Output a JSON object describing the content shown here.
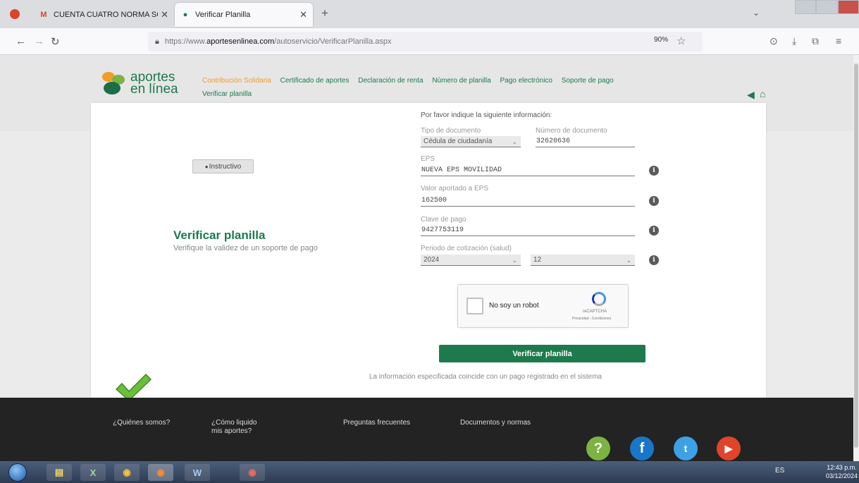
{
  "browser": {
    "tabs": [
      {
        "label": "CUENTA CUATRO NORMA SO",
        "favicon": "gmail-icon",
        "active": false
      },
      {
        "label": "Verificar Planilla",
        "favicon": "aportes-icon",
        "active": true
      }
    ],
    "url_prefix": "https://www.",
    "url_host": "aportesenlinea.com",
    "url_path": "/autoservicio/VerificarPlanilla.aspx",
    "zoom": "90%"
  },
  "site": {
    "logo_line1": "aportes",
    "logo_line2": "en línea",
    "nav": [
      "Contribución Solidaria",
      "Certificado de aportes",
      "Declaración de renta",
      "Número de planilla",
      "Pago electrónico",
      "Soporte de pago",
      "Verificar planilla"
    ],
    "accent_color": "#1d7a4c",
    "active_nav_color": "#f39c28"
  },
  "left": {
    "instructivo_label": "Instructivo",
    "title": "Verificar planilla",
    "subtitle": "Verifique la validez de un soporte de pago"
  },
  "form": {
    "heading": "Por favor indique la siguiente información:",
    "doc_type_label": "Tipo de documento",
    "doc_type_value": "Cédula de ciudadanía",
    "doc_number_label": "Número de documento",
    "doc_number_value": "32620636",
    "eps_label": "EPS",
    "eps_value": "NUEVA EPS MOVILIDAD",
    "valor_label": "Valor aportado a EPS",
    "valor_value": "162500",
    "clave_label": "Clave de pago",
    "clave_value": "9427753119",
    "periodo_label": "Periodo de cotización (salud)",
    "periodo_year": "2024",
    "periodo_month": "12",
    "info_glyph": "i"
  },
  "captcha": {
    "label": "No soy un robot",
    "brand": "reCAPTCHA",
    "links": "Privacidad - Condiciones"
  },
  "actions": {
    "verify_label": "Verificar planilla"
  },
  "result": {
    "message": "La información especificada coincide con un pago registrado en el sistema"
  },
  "footer": {
    "links": [
      "¿Quiénes somos?",
      "¿Cómo liquido mis aportes?",
      "Preguntas frecuentes",
      "Documentos y normas"
    ],
    "social": [
      {
        "name": "help-icon",
        "glyph": "?",
        "color": "#7cb342"
      },
      {
        "name": "facebook-icon",
        "glyph": "f",
        "color": "#1877c9"
      },
      {
        "name": "twitter-icon",
        "glyph": "t",
        "color": "#3ea1e6"
      },
      {
        "name": "youtube-icon",
        "glyph": "▶",
        "color": "#e0452a"
      }
    ]
  },
  "taskbar": {
    "tray": "ES",
    "time": "12:43 p.m.",
    "date": "03/12/2024"
  }
}
